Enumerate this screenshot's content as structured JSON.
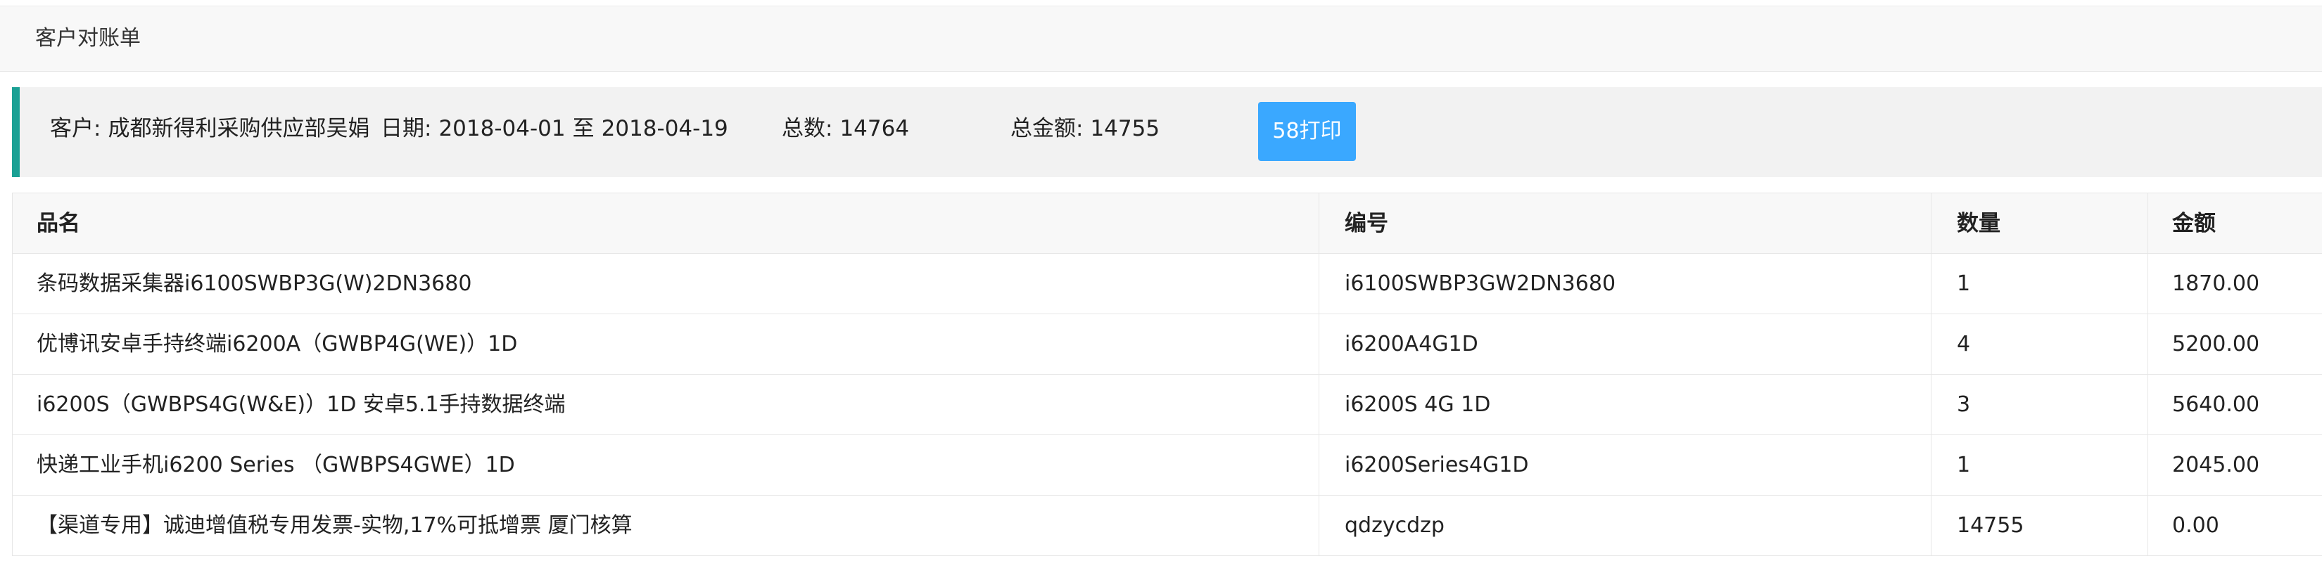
{
  "header": {
    "title": "客户对账单"
  },
  "summary": {
    "customer_label": "客户:",
    "customer_value": "成都新得利采购供应部吴娟",
    "date_label": "日期:",
    "date_start": "2018-04-01",
    "date_sep": "至",
    "date_end": "2018-04-19",
    "count_label": "总数:",
    "count_value": "14764",
    "amount_label": "总金额:",
    "amount_value": "14755",
    "print_label": "58打印"
  },
  "table": {
    "columns": [
      "品名",
      "编号",
      "数量",
      "金额"
    ],
    "rows": [
      [
        "条码数据采集器i6100SWBP3G(W)2DN3680",
        "i6100SWBP3GW2DN3680",
        "1",
        "1870.00"
      ],
      [
        "优博讯安卓手持终端i6200A（GWBP4G(WE)）1D",
        "i6200A4G1D",
        "4",
        "5200.00"
      ],
      [
        "i6200S（GWBPS4G(W&E)）1D 安卓5.1手持数据终端",
        "i6200S 4G 1D",
        "3",
        "5640.00"
      ],
      [
        "快递工业手机i6200 Series （GWBPS4GWE）1D",
        "i6200Series4G1D",
        "1",
        "2045.00"
      ],
      [
        "【渠道专用】诚迪增值税专用发票-实物,17%可抵增票 厦门核算",
        "qdzycdzp",
        "14755",
        "0.00"
      ]
    ]
  },
  "colors": {
    "accent": "#1aa094",
    "button": "#3aa8ff",
    "header_bg": "#f8f8f8",
    "summary_bg": "#f2f2f2",
    "border": "#e6e6e6"
  }
}
